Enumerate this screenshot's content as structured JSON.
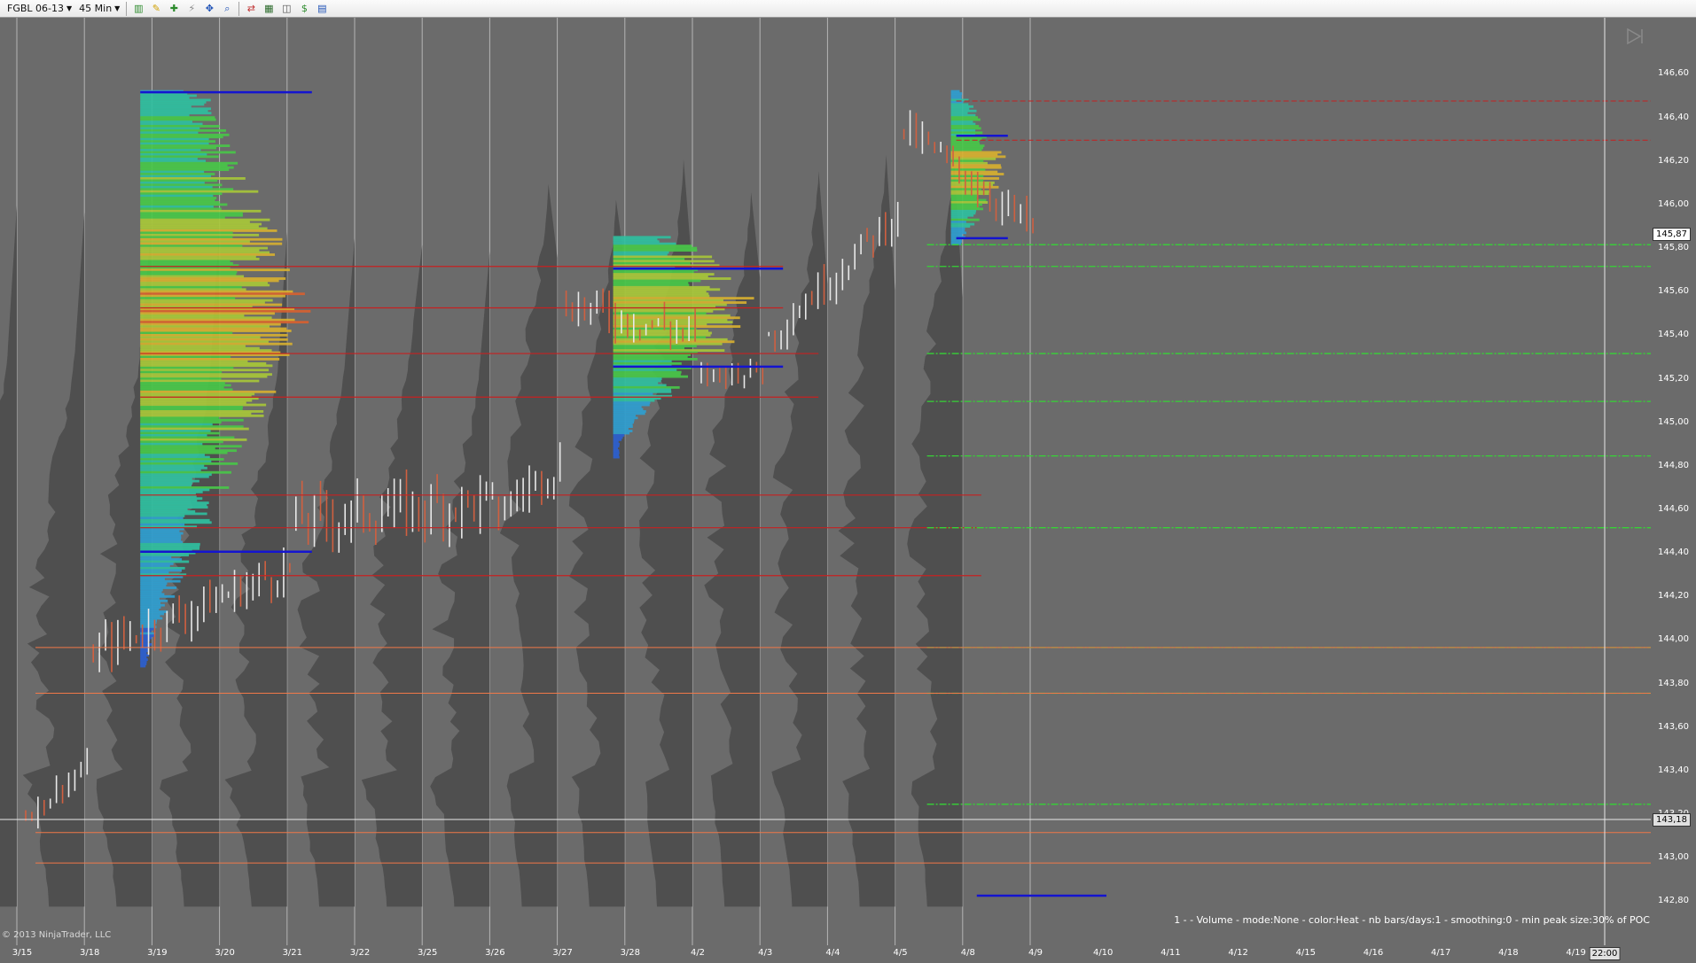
{
  "toolbar": {
    "instrument": "FGBL 06-13",
    "interval": "45 Min",
    "buttons": [
      {
        "name": "bar-type-icon",
        "glyph": "▥",
        "interactable": true
      },
      {
        "name": "drawing-pencil-icon",
        "glyph": "✎",
        "interactable": true
      },
      {
        "name": "indicator-icon",
        "glyph": "✚",
        "interactable": true
      },
      {
        "name": "strategy-icon",
        "glyph": "⚡",
        "interactable": true
      },
      {
        "name": "crosshair-icon",
        "glyph": "✥",
        "interactable": true
      },
      {
        "name": "zoom-icon",
        "glyph": "⌕",
        "interactable": true
      },
      {
        "name": "chart-trader-icon",
        "glyph": "⇄",
        "interactable": true
      },
      {
        "name": "properties-icon",
        "glyph": "▦",
        "interactable": true
      },
      {
        "name": "data-box-icon",
        "glyph": "◫",
        "interactable": true
      },
      {
        "name": "strategy-analyzer-icon",
        "glyph": "$",
        "interactable": true
      },
      {
        "name": "template-icon",
        "glyph": "▤",
        "interactable": true
      }
    ]
  },
  "colors": {
    "background": "#6b6b6b",
    "poc_line": "#c62020",
    "value_area": "#1414d0",
    "green_dash": "#36d436",
    "orange_level": "#f07848",
    "ghost_profile": "#4a4a4a",
    "session_line": "#b5b5b5"
  },
  "chart_data": {
    "type": "candlestick-volume-profile",
    "ylim": [
      142.7,
      146.72
    ],
    "price_ticks": [
      "146,60",
      "146,40",
      "146,20",
      "146,00",
      "145,80",
      "145,60",
      "145,40",
      "145,20",
      "145,00",
      "144,80",
      "144,60",
      "144,40",
      "144,20",
      "144,00",
      "143,80",
      "143,60",
      "143,40",
      "143,20",
      "143,00",
      "142,80"
    ],
    "date_ticks": [
      "3/15",
      "3/18",
      "3/19",
      "3/20",
      "3/21",
      "3/22",
      "3/25",
      "3/26",
      "3/27",
      "3/28",
      "4/2",
      "4/3",
      "4/4",
      "4/5",
      "4/8",
      "4/9",
      "4/10",
      "4/11",
      "4/12",
      "4/15",
      "4/16",
      "4/17",
      "4/18",
      "4/19"
    ],
    "last_price": "145,87",
    "crosshair_price": "143,18",
    "crosshair_time": "22:00",
    "poc_levels": [
      145.72,
      145.53,
      145.32,
      145.12,
      144.67,
      144.52,
      144.3
    ],
    "value_area_high": [
      146.52,
      145.71,
      146.32
    ],
    "value_area_low": [
      144.41,
      145.26,
      145.85
    ],
    "green_levels": [
      145.82,
      145.72,
      145.32,
      145.1,
      144.85,
      144.52,
      143.97,
      143.76,
      143.25
    ],
    "orange_levels": [
      143.97,
      143.76,
      143.12,
      142.98
    ],
    "profiles": [
      {
        "start": "3/18",
        "end": "3/20",
        "high": 146.53,
        "low": 143.88,
        "poc": 145.53
      },
      {
        "start": "3/27",
        "end": "4/3",
        "high": 145.86,
        "low": 144.84,
        "poc": 145.53
      },
      {
        "start": "4/5",
        "end": "4/9",
        "high": 146.53,
        "low": 145.82,
        "poc": 146.18
      }
    ]
  },
  "copyright": "© 2013 NinjaTrader, LLC",
  "indicator_label": "1 -  - Volume - mode:None - color:Heat - nb bars/days:1 - smoothing:0 - min peak size:30% of POC"
}
